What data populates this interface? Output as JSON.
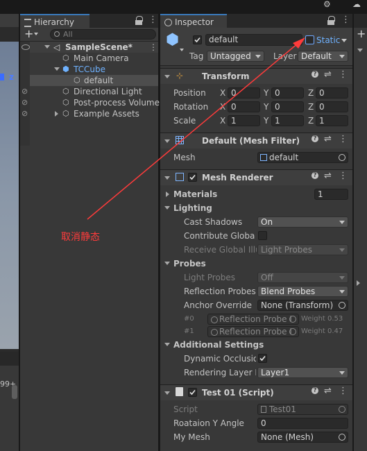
{
  "hierarchy": {
    "tab_label": "Hierarchy",
    "search_placeholder": "All",
    "scene_name": "SampleScene*",
    "items": [
      {
        "label": "Main Camera"
      },
      {
        "label": "TCCube"
      },
      {
        "label": "default"
      },
      {
        "label": "Directional Light"
      },
      {
        "label": "Post-process Volume"
      },
      {
        "label": "Example Assets"
      }
    ]
  },
  "scene_view": {
    "axis_label": "z",
    "counter_text": "99+"
  },
  "inspector": {
    "tab_label": "Inspector",
    "object_name": "default",
    "static_label": "Static",
    "tag_label": "Tag",
    "tag_value": "Untagged",
    "layer_label": "Layer",
    "layer_value": "Default",
    "transform": {
      "title": "Transform",
      "rows": [
        {
          "label": "Position",
          "x": "0",
          "y": "0",
          "z": "0"
        },
        {
          "label": "Rotation",
          "x": "0",
          "y": "0",
          "z": "0"
        },
        {
          "label": "Scale",
          "x": "1",
          "y": "1",
          "z": "1"
        }
      ],
      "axis_x": "X",
      "axis_y": "Y",
      "axis_z": "Z"
    },
    "mesh_filter": {
      "title": "Default (Mesh Filter)",
      "mesh_label": "Mesh",
      "mesh_value": "default"
    },
    "mesh_renderer": {
      "title": "Mesh Renderer",
      "materials_label": "Materials",
      "materials_count": "1",
      "lighting_label": "Lighting",
      "cast_shadows_label": "Cast Shadows",
      "cast_shadows_value": "On",
      "contribute_gi_label": "Contribute Global I",
      "receive_gi_label": "Receive Global Illu",
      "receive_gi_value": "Light Probes",
      "probes_label": "Probes",
      "light_probes_label": "Light Probes",
      "light_probes_value": "Off",
      "reflection_probes_label": "Reflection Probes",
      "reflection_probes_value": "Blend Probes",
      "anchor_override_label": "Anchor Override",
      "anchor_override_value": "None (Transform)",
      "probe_rows": [
        {
          "index": "#0",
          "name": "Reflection Probe I",
          "weight": "Weight 0.53"
        },
        {
          "index": "#1",
          "name": "Reflection Probe I",
          "weight": "Weight 0.47"
        }
      ],
      "additional_settings_label": "Additional Settings",
      "dynamic_occlusion_label": "Dynamic Occlusio",
      "rendering_layer_label": "Rendering Layer M",
      "rendering_layer_value": "Layer1"
    },
    "script_component": {
      "title": "Test 01 (Script)",
      "script_label": "Script",
      "script_value": "Test01",
      "rot_label": "Roataion Y Angle",
      "rot_value": "0",
      "mymesh_label": "My Mesh",
      "mymesh_value": "None (Mesh)"
    }
  },
  "annotation": {
    "text": "取消静态",
    "color": "#ff3b3b"
  },
  "colors": {
    "accent_blue": "#3a79bb",
    "selected_row": "#4d4d4d",
    "prefab_blue": "#6fb2ff"
  }
}
